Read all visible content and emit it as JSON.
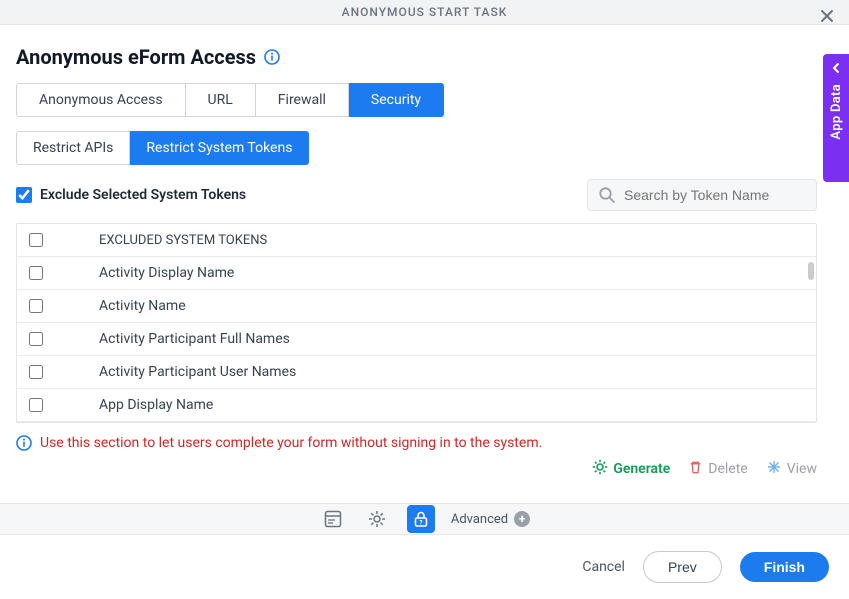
{
  "titlebar": {
    "title": "ANONYMOUS START TASK"
  },
  "page": {
    "title": "Anonymous eForm Access"
  },
  "tabs": [
    {
      "label": "Anonymous Access",
      "active": false
    },
    {
      "label": "URL",
      "active": false
    },
    {
      "label": "Firewall",
      "active": false
    },
    {
      "label": "Security",
      "active": true
    }
  ],
  "subtabs": [
    {
      "label": "Restrict APIs",
      "active": false
    },
    {
      "label": "Restrict System Tokens",
      "active": true
    }
  ],
  "exclude": {
    "label": "Exclude Selected System Tokens",
    "checked": true
  },
  "search": {
    "placeholder": "Search by Token Name",
    "value": ""
  },
  "table": {
    "header": "EXCLUDED SYSTEM TOKENS",
    "rows": [
      {
        "name": "Activity Display Name",
        "checked": false
      },
      {
        "name": "Activity Name",
        "checked": false
      },
      {
        "name": "Activity Participant Full Names",
        "checked": false
      },
      {
        "name": "Activity Participant User Names",
        "checked": false
      },
      {
        "name": "App Display Name",
        "checked": false
      }
    ]
  },
  "info_message": "Use this section to let users complete your form without signing in to the system.",
  "actions": {
    "generate": "Generate",
    "delete": "Delete",
    "view": "View"
  },
  "toolbar": {
    "advanced": "Advanced"
  },
  "footer": {
    "cancel": "Cancel",
    "prev": "Prev",
    "finish": "Finish"
  },
  "side_panel": {
    "label": "App Data"
  },
  "colors": {
    "primary": "#1d7bf0",
    "purple": "#7b2ff0",
    "green": "#0f9d58",
    "danger": "#d02626"
  }
}
